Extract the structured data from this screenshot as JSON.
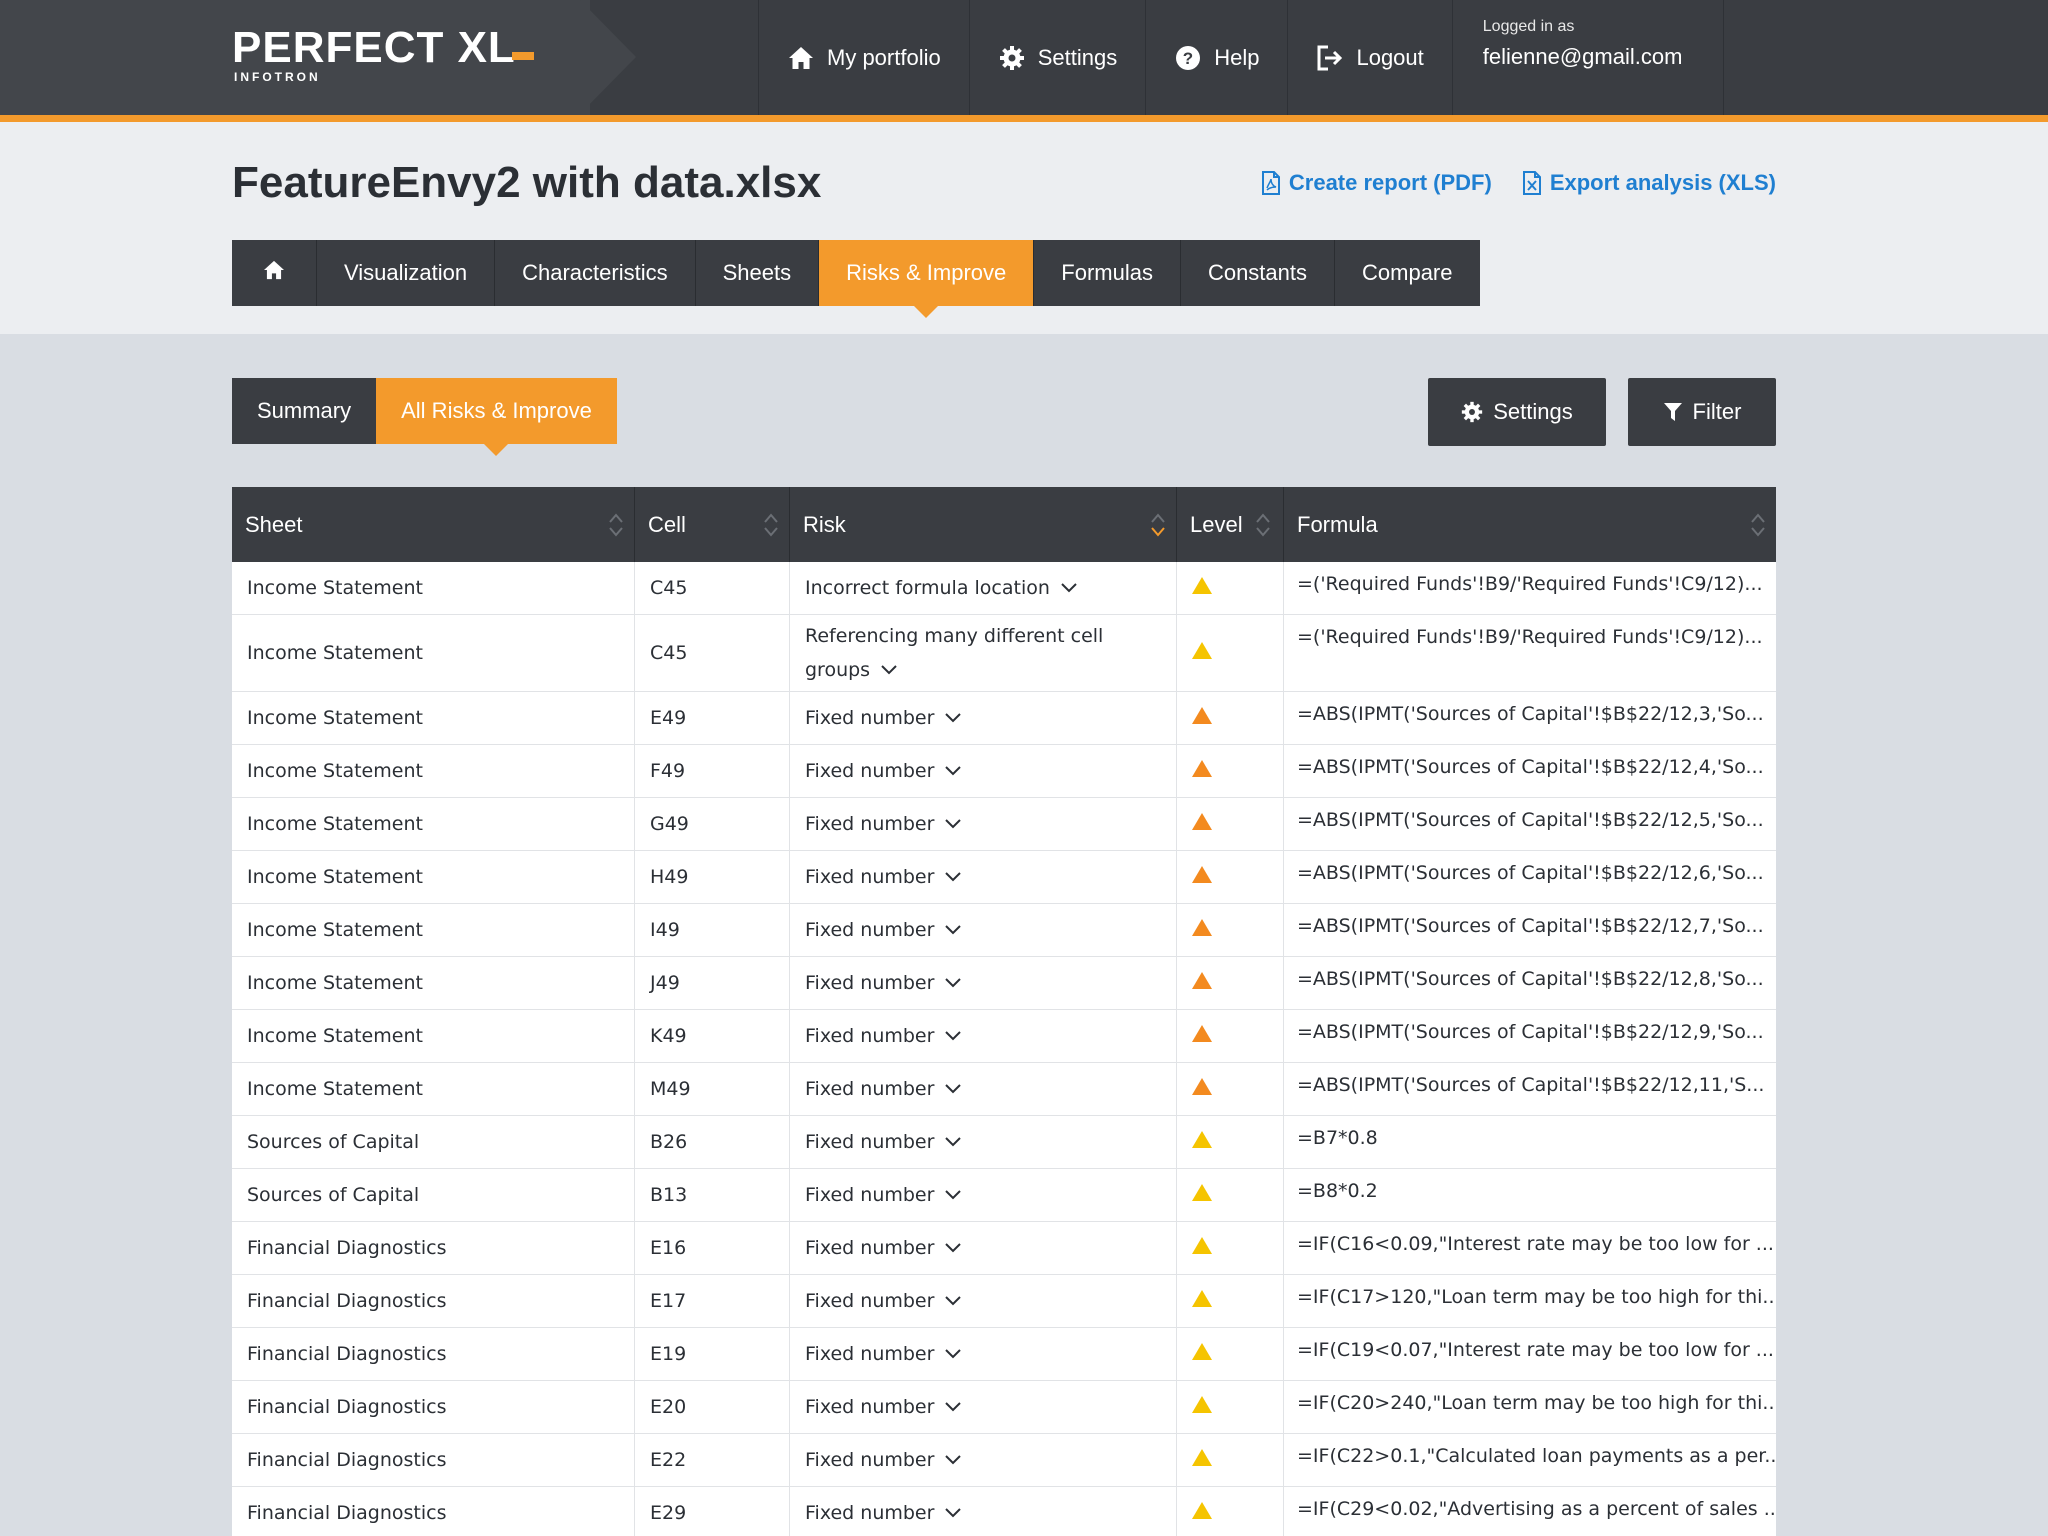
{
  "app": {
    "logo_text": "PERFECT XL",
    "logo_sub": "INFOTRON"
  },
  "topnav": {
    "items": [
      {
        "label": "My portfolio",
        "icon": "home-icon"
      },
      {
        "label": "Settings",
        "icon": "gear-icon"
      },
      {
        "label": "Help",
        "icon": "help-icon"
      },
      {
        "label": "Logout",
        "icon": "logout-icon"
      }
    ],
    "logged_in_label": "Logged in as",
    "user_email": "felienne@gmail.com"
  },
  "header": {
    "file_title": "FeatureEnvy2 with data.xlsx",
    "create_report": "Create report (PDF)",
    "export_analysis": "Export analysis (XLS)"
  },
  "main_tabs": [
    {
      "label": "",
      "icon": "home-icon"
    },
    {
      "label": "Visualization"
    },
    {
      "label": "Characteristics"
    },
    {
      "label": "Sheets"
    },
    {
      "label": "Risks & Improve",
      "active": true
    },
    {
      "label": "Formulas"
    },
    {
      "label": "Constants"
    },
    {
      "label": "Compare"
    }
  ],
  "sub_tabs": [
    {
      "label": "Summary"
    },
    {
      "label": "All Risks & Improve",
      "active": true
    }
  ],
  "tools": {
    "settings_label": "Settings",
    "filter_label": "Filter"
  },
  "table": {
    "columns": [
      "Sheet",
      "Cell",
      "Risk",
      "Level",
      "Formula"
    ],
    "level_colors": {
      "yellow": "#f5c400",
      "orange": "#f38a1f"
    },
    "rows": [
      {
        "sheet": "Income Statement",
        "cell": "C45",
        "risk": "Incorrect formula location",
        "level": "yellow",
        "formula": "=('Required Funds'!B9/'Required Funds'!C9/12)..."
      },
      {
        "sheet": "Income Statement",
        "cell": "C45",
        "risk": "Referencing many different cell groups",
        "level": "yellow",
        "formula": "=('Required Funds'!B9/'Required Funds'!C9/12)...",
        "tall": true
      },
      {
        "sheet": "Income Statement",
        "cell": "E49",
        "risk": "Fixed number",
        "level": "orange",
        "formula": "=ABS(IPMT('Sources of Capital'!$B$22/12,3,'So..."
      },
      {
        "sheet": "Income Statement",
        "cell": "F49",
        "risk": "Fixed number",
        "level": "orange",
        "formula": "=ABS(IPMT('Sources of Capital'!$B$22/12,4,'So..."
      },
      {
        "sheet": "Income Statement",
        "cell": "G49",
        "risk": "Fixed number",
        "level": "orange",
        "formula": "=ABS(IPMT('Sources of Capital'!$B$22/12,5,'So..."
      },
      {
        "sheet": "Income Statement",
        "cell": "H49",
        "risk": "Fixed number",
        "level": "orange",
        "formula": "=ABS(IPMT('Sources of Capital'!$B$22/12,6,'So..."
      },
      {
        "sheet": "Income Statement",
        "cell": "I49",
        "risk": "Fixed number",
        "level": "orange",
        "formula": "=ABS(IPMT('Sources of Capital'!$B$22/12,7,'So..."
      },
      {
        "sheet": "Income Statement",
        "cell": "J49",
        "risk": "Fixed number",
        "level": "orange",
        "formula": "=ABS(IPMT('Sources of Capital'!$B$22/12,8,'So..."
      },
      {
        "sheet": "Income Statement",
        "cell": "K49",
        "risk": "Fixed number",
        "level": "orange",
        "formula": "=ABS(IPMT('Sources of Capital'!$B$22/12,9,'So..."
      },
      {
        "sheet": "Income Statement",
        "cell": "M49",
        "risk": "Fixed number",
        "level": "orange",
        "formula": "=ABS(IPMT('Sources of Capital'!$B$22/12,11,'S..."
      },
      {
        "sheet": "Sources of Capital",
        "cell": "B26",
        "risk": "Fixed number",
        "level": "yellow",
        "formula": "=B7*0.8"
      },
      {
        "sheet": "Sources of Capital",
        "cell": "B13",
        "risk": "Fixed number",
        "level": "yellow",
        "formula": "=B8*0.2"
      },
      {
        "sheet": "Financial Diagnostics",
        "cell": "E16",
        "risk": "Fixed number",
        "level": "yellow",
        "formula": "=IF(C16<0.09,\"Interest rate may be too low for ..."
      },
      {
        "sheet": "Financial Diagnostics",
        "cell": "E17",
        "risk": "Fixed number",
        "level": "yellow",
        "formula": "=IF(C17>120,\"Loan term may be too high for thi..."
      },
      {
        "sheet": "Financial Diagnostics",
        "cell": "E19",
        "risk": "Fixed number",
        "level": "yellow",
        "formula": "=IF(C19<0.07,\"Interest rate may be too low for ..."
      },
      {
        "sheet": "Financial Diagnostics",
        "cell": "E20",
        "risk": "Fixed number",
        "level": "yellow",
        "formula": "=IF(C20>240,\"Loan term may be too high for thi..."
      },
      {
        "sheet": "Financial Diagnostics",
        "cell": "E22",
        "risk": "Fixed number",
        "level": "yellow",
        "formula": "=IF(C22>0.1,\"Calculated loan payments as a per..."
      },
      {
        "sheet": "Financial Diagnostics",
        "cell": "E29",
        "risk": "Fixed number",
        "level": "yellow",
        "formula": "=IF(C29<0.02,\"Advertising as a percent of sales ..."
      }
    ]
  }
}
